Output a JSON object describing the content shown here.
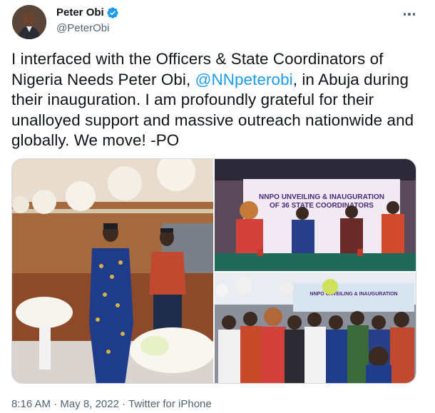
{
  "author": {
    "display_name": "Peter Obi",
    "handle": "@PeterObi",
    "verified": true,
    "verified_icon": "verified-badge-icon",
    "avatar_icon": "avatar"
  },
  "more_icon": "more-options-icon",
  "tweet": {
    "text_before": "I interfaced with the Officers & State  Coordinators of Nigeria Needs Peter Obi, ",
    "mention": "@NNpeterobi",
    "text_after": ", in Abuja during their inauguration. I am profoundly grateful for their unalloyed support and massive outreach nationwide and globally. We move! -PO"
  },
  "media": {
    "photo_count": 3,
    "banner_line1": "NNPO UNVEILING & INAUGURATION",
    "banner_line2": "OF 36 STATE COORDINATORS",
    "banner3_line1": "NNPO UNVEILING & INAUGURATION"
  },
  "meta": {
    "time": "8:16 AM",
    "separator": " · ",
    "date": "May 8, 2022",
    "source": "Twitter for iPhone"
  },
  "colors": {
    "text": "#0f1419",
    "secondary": "#536471",
    "accent": "#1d9bf0",
    "border": "#cfd9de"
  }
}
